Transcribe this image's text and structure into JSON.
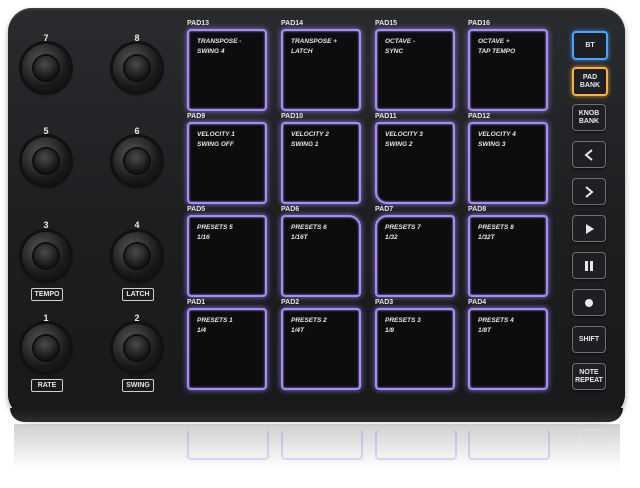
{
  "knobs": [
    {
      "number": "7",
      "box": ""
    },
    {
      "number": "8",
      "box": ""
    },
    {
      "number": "5",
      "box": ""
    },
    {
      "number": "6",
      "box": ""
    },
    {
      "number": "3",
      "box": "TEMPO"
    },
    {
      "number": "4",
      "box": "LATCH"
    },
    {
      "number": "1",
      "box": "RATE"
    },
    {
      "number": "2",
      "box": "SWING"
    }
  ],
  "pads": [
    {
      "id": "PAD13",
      "line1": "TRANSPOSE -",
      "line2": "SWING 4"
    },
    {
      "id": "PAD14",
      "line1": "TRANSPOSE +",
      "line2": "LATCH"
    },
    {
      "id": "PAD15",
      "line1": "OCTAVE -",
      "line2": "SYNC"
    },
    {
      "id": "PAD16",
      "line1": "OCTAVE +",
      "line2": "TAP TEMPO"
    },
    {
      "id": "PAD9",
      "line1": "VELOCITY 1",
      "line2": "SWING OFF"
    },
    {
      "id": "PAD10",
      "line1": "VELOCITY 2",
      "line2": "SWING 1"
    },
    {
      "id": "PAD11",
      "line1": "VELOCITY 3",
      "line2": "SWING 2"
    },
    {
      "id": "PAD12",
      "line1": "VELOCITY 4",
      "line2": "SWING 3"
    },
    {
      "id": "PAD5",
      "line1": "PRESETS 5",
      "line2": "1/16"
    },
    {
      "id": "PAD6",
      "line1": "PRESETS 6",
      "line2": "1/16T"
    },
    {
      "id": "PAD7",
      "line1": "PRESETS 7",
      "line2": "1/32"
    },
    {
      "id": "PAD8",
      "line1": "PRESETS 8",
      "line2": "1/32T"
    },
    {
      "id": "PAD1",
      "line1": "PRESETS 1",
      "line2": "1/4"
    },
    {
      "id": "PAD2",
      "line1": "PRESETS 2",
      "line2": "1/4T"
    },
    {
      "id": "PAD3",
      "line1": "PRESETS 3",
      "line2": "1/8"
    },
    {
      "id": "PAD4",
      "line1": "PRESETS 4",
      "line2": "1/8T"
    }
  ],
  "buttons": {
    "bt": "BT",
    "pad_bank_1": "PAD",
    "pad_bank_2": "BANK",
    "knob_bank_1": "KNOB",
    "knob_bank_2": "BANK",
    "shift": "SHIFT",
    "note_repeat_1": "NOTE",
    "note_repeat_2": "REPEAT"
  },
  "icons": {
    "prev": "chevron-left-icon",
    "next": "chevron-right-icon",
    "play": "play-icon",
    "pause": "pause-icon",
    "record": "record-icon"
  },
  "colors": {
    "pad_glow": "#a78bfa",
    "bt_accent": "#4aa3ff",
    "pad_bank_accent": "#ffb13b",
    "body": "#1f2022"
  }
}
